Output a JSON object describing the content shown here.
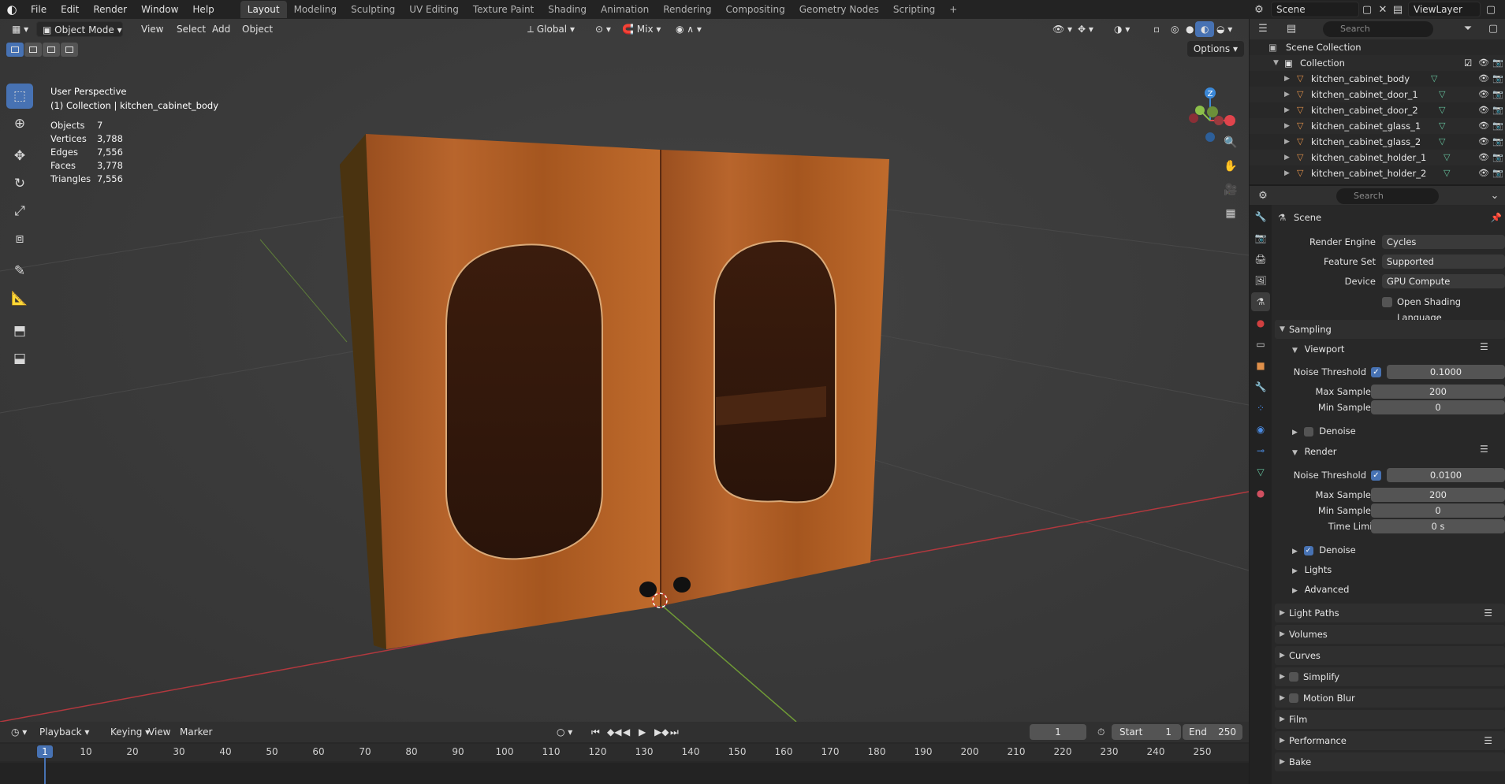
{
  "topbar": {
    "menus": [
      "File",
      "Edit",
      "Render",
      "Window",
      "Help"
    ],
    "workspaces": [
      "Layout",
      "Modeling",
      "Sculpting",
      "UV Editing",
      "Texture Paint",
      "Shading",
      "Animation",
      "Rendering",
      "Compositing",
      "Geometry Nodes",
      "Scripting"
    ],
    "active_workspace": "Layout",
    "add_workspace": "+",
    "scene_label": "Scene",
    "viewlayer_label": "ViewLayer"
  },
  "viewport": {
    "mode": "Object Mode",
    "menus": [
      "View",
      "Select",
      "Add",
      "Object"
    ],
    "orientation": "Global",
    "snap": "Mix",
    "options_label": "Options",
    "perspective_label": "User Perspective",
    "collection_info": "(1) Collection | kitchen_cabinet_body",
    "stats": [
      {
        "key": "Objects",
        "value": "7"
      },
      {
        "key": "Vertices",
        "value": "3,788"
      },
      {
        "key": "Edges",
        "value": "7,556"
      },
      {
        "key": "Faces",
        "value": "3,778"
      },
      {
        "key": "Triangles",
        "value": "7,556"
      }
    ],
    "gizmo": {
      "x": "X",
      "y": "Y",
      "z": "Z"
    }
  },
  "outliner": {
    "search_placeholder": "Search",
    "scene_collection": "Scene Collection",
    "collection": "Collection",
    "objects": [
      "kitchen_cabinet_body",
      "kitchen_cabinet_door_1",
      "kitchen_cabinet_door_2",
      "kitchen_cabinet_glass_1",
      "kitchen_cabinet_glass_2",
      "kitchen_cabinet_holder_1",
      "kitchen_cabinet_holder_2"
    ]
  },
  "properties": {
    "search_placeholder": "Search",
    "context": "Scene",
    "render_engine_label": "Render Engine",
    "render_engine": "Cycles",
    "feature_set_label": "Feature Set",
    "feature_set": "Supported",
    "device_label": "Device",
    "device": "GPU Compute",
    "osl_label": "Open Shading Language",
    "sampling": "Sampling",
    "viewport": {
      "title": "Viewport",
      "noise_label": "Noise Threshold",
      "noise": "0.1000",
      "max_label": "Max Samples",
      "max": "200",
      "min_label": "Min Samples",
      "min": "0",
      "denoise": "Denoise"
    },
    "render": {
      "title": "Render",
      "noise_label": "Noise Threshold",
      "noise": "0.0100",
      "max_label": "Max Samples",
      "max": "200",
      "min_label": "Min Samples",
      "min": "0",
      "time_label": "Time Limit",
      "time": "0 s",
      "denoise": "Denoise"
    },
    "lights": "Lights",
    "advanced": "Advanced",
    "panels": [
      "Light Paths",
      "Volumes",
      "Curves",
      "Simplify",
      "Motion Blur",
      "Film",
      "Performance",
      "Bake"
    ]
  },
  "timeline": {
    "menus": [
      "Playback",
      "Keying",
      "View",
      "Marker"
    ],
    "current_frame": "1",
    "start_label": "Start",
    "start": "1",
    "end_label": "End",
    "end": "250",
    "ticks": [
      "10",
      "20",
      "30",
      "40",
      "50",
      "60",
      "70",
      "80",
      "90",
      "100",
      "110",
      "120",
      "130",
      "140",
      "150",
      "160",
      "170",
      "180",
      "190",
      "200",
      "210",
      "220",
      "230",
      "240",
      "250"
    ]
  },
  "colors": {
    "accent": "#4772b3",
    "object_orange": "#e0904a",
    "mesh_green": "#65c29d",
    "axis_x": "#e0444c",
    "axis_y": "#8cc04a",
    "axis_z": "#3b88d8"
  }
}
